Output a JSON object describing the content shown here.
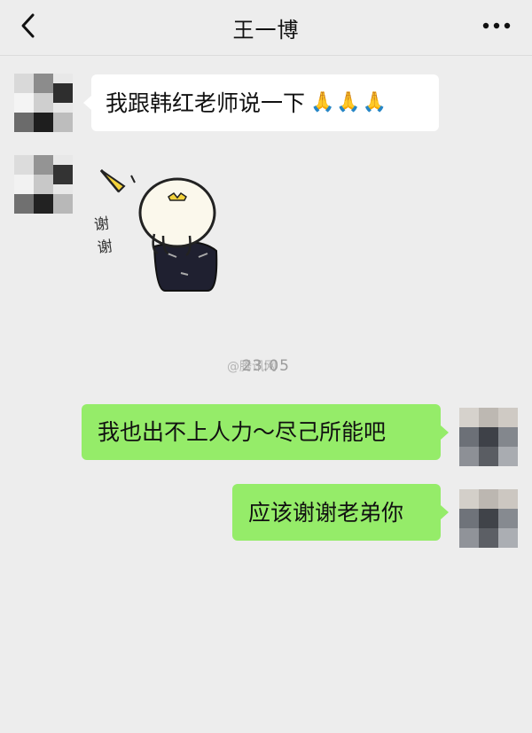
{
  "header": {
    "title": "王一博",
    "back_icon": "chevron-left-icon",
    "more_icon": "ellipsis-icon"
  },
  "messages": [
    {
      "side": "left",
      "type": "text",
      "text": "我跟韩红老师说一下",
      "emoji": "🙏🙏🙏"
    },
    {
      "side": "left",
      "type": "sticker",
      "sticker_text": "谢谢"
    },
    {
      "type": "timestamp",
      "text": "23:05"
    },
    {
      "side": "right",
      "type": "text",
      "text": "我也出不上人力～尽己所能吧"
    },
    {
      "side": "right",
      "type": "text",
      "text": "应该谢谢老弟你"
    }
  ],
  "watermark": "@腾讯网",
  "colors": {
    "background": "#ededed",
    "bubble_left": "#ffffff",
    "bubble_right": "#95ec69"
  }
}
